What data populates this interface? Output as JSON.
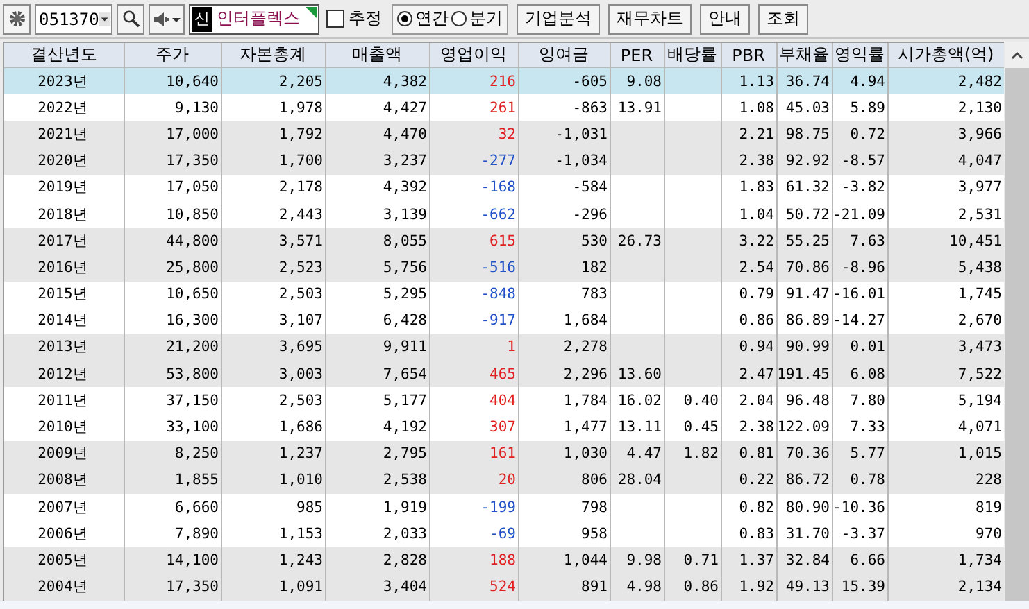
{
  "toolbar": {
    "code": "051370",
    "badge": "신",
    "stock_name": "인터플렉스",
    "estimate": {
      "label": "추정",
      "checked": false
    },
    "periods": [
      {
        "label": "연간",
        "selected": true
      },
      {
        "label": "분기",
        "selected": false
      }
    ],
    "buttons": [
      "기업분석",
      "재무차트",
      "안내",
      "조회"
    ]
  },
  "table": {
    "columns": [
      "결산년도",
      "주가",
      "자본총계",
      "매출액",
      "영업이익",
      "잉여금",
      "PER",
      "배당률",
      "PBR",
      "부채율",
      "영익률",
      "시가총액(억)"
    ],
    "rows": [
      {
        "selected": true,
        "color": "#e02020",
        "cells": [
          "2023년",
          "10,640",
          "2,205",
          "4,382",
          "216",
          "-605",
          "9.08",
          null,
          "1.13",
          "36.74",
          "4.94",
          "2,482"
        ]
      },
      {
        "selected": false,
        "color": "#e02020",
        "cells": [
          "2022년",
          "9,130",
          "1,978",
          "4,427",
          "261",
          "-863",
          "13.91",
          null,
          "1.08",
          "45.03",
          "5.89",
          "2,130"
        ]
      },
      {
        "selected": false,
        "color": "#e02020",
        "cells": [
          "2021년",
          "17,000",
          "1,792",
          "4,470",
          "32",
          "-1,031",
          null,
          null,
          "2.21",
          "98.75",
          "0.72",
          "3,966"
        ]
      },
      {
        "selected": false,
        "color": "#2050c8",
        "cells": [
          "2020년",
          "17,350",
          "1,700",
          "3,237",
          "-277",
          "-1,034",
          null,
          null,
          "2.38",
          "92.92",
          "-8.57",
          "4,047"
        ]
      },
      {
        "selected": false,
        "color": "#2050c8",
        "cells": [
          "2019년",
          "17,050",
          "2,178",
          "4,392",
          "-168",
          "-584",
          null,
          null,
          "1.83",
          "61.32",
          "-3.82",
          "3,977"
        ]
      },
      {
        "selected": false,
        "color": "#2050c8",
        "cells": [
          "2018년",
          "10,850",
          "2,443",
          "3,139",
          "-662",
          "-296",
          null,
          null,
          "1.04",
          "50.72",
          "-21.09",
          "2,531"
        ]
      },
      {
        "selected": false,
        "color": "#e02020",
        "cells": [
          "2017년",
          "44,800",
          "3,571",
          "8,055",
          "615",
          "530",
          "26.73",
          null,
          "3.22",
          "55.25",
          "7.63",
          "10,451"
        ]
      },
      {
        "selected": false,
        "color": "#2050c8",
        "cells": [
          "2016년",
          "25,800",
          "2,523",
          "5,756",
          "-516",
          "182",
          null,
          null,
          "2.54",
          "70.86",
          "-8.96",
          "5,438"
        ]
      },
      {
        "selected": false,
        "color": "#2050c8",
        "cells": [
          "2015년",
          "10,650",
          "2,503",
          "5,295",
          "-848",
          "783",
          null,
          null,
          "0.79",
          "91.47",
          "-16.01",
          "1,745"
        ]
      },
      {
        "selected": false,
        "color": "#2050c8",
        "cells": [
          "2014년",
          "16,300",
          "3,107",
          "6,428",
          "-917",
          "1,684",
          null,
          null,
          "0.86",
          "86.89",
          "-14.27",
          "2,670"
        ]
      },
      {
        "selected": false,
        "color": "#e02020",
        "cells": [
          "2013년",
          "21,200",
          "3,695",
          "9,911",
          "1",
          "2,278",
          null,
          null,
          "0.94",
          "90.99",
          "0.01",
          "3,473"
        ]
      },
      {
        "selected": false,
        "color": "#e02020",
        "cells": [
          "2012년",
          "53,800",
          "3,003",
          "7,654",
          "465",
          "2,296",
          "13.60",
          null,
          "2.47",
          "191.45",
          "6.08",
          "7,522"
        ]
      },
      {
        "selected": false,
        "color": "#e02020",
        "cells": [
          "2011년",
          "37,150",
          "2,503",
          "5,177",
          "404",
          "1,784",
          "16.02",
          "0.40",
          "2.04",
          "96.48",
          "7.80",
          "5,194"
        ]
      },
      {
        "selected": false,
        "color": "#e02020",
        "cells": [
          "2010년",
          "33,100",
          "1,686",
          "4,192",
          "307",
          "1,477",
          "13.11",
          "0.45",
          "2.38",
          "122.09",
          "7.33",
          "4,071"
        ]
      },
      {
        "selected": false,
        "color": "#e02020",
        "cells": [
          "2009년",
          "8,250",
          "1,237",
          "2,795",
          "161",
          "1,030",
          "4.47",
          "1.82",
          "0.81",
          "70.36",
          "5.77",
          "1,015"
        ]
      },
      {
        "selected": false,
        "color": "#e02020",
        "cells": [
          "2008년",
          "1,855",
          "1,010",
          "2,538",
          "20",
          "806",
          "28.04",
          null,
          "0.22",
          "86.72",
          "0.78",
          "228"
        ]
      },
      {
        "selected": false,
        "color": "#2050c8",
        "cells": [
          "2007년",
          "6,660",
          "985",
          "1,919",
          "-199",
          "798",
          null,
          null,
          "0.82",
          "80.90",
          "-10.36",
          "819"
        ]
      },
      {
        "selected": false,
        "color": "#2050c8",
        "cells": [
          "2006년",
          "7,890",
          "1,153",
          "2,033",
          "-69",
          "958",
          null,
          null,
          "0.83",
          "31.70",
          "-3.37",
          "970"
        ]
      },
      {
        "selected": false,
        "color": "#e02020",
        "cells": [
          "2005년",
          "14,100",
          "1,243",
          "2,828",
          "188",
          "1,044",
          "9.98",
          "0.71",
          "1.37",
          "32.84",
          "6.66",
          "1,734"
        ]
      },
      {
        "selected": false,
        "color": "#e02020",
        "cells": [
          "2004년",
          "17,350",
          "1,091",
          "3,404",
          "524",
          "891",
          "4.98",
          "0.86",
          "1.92",
          "49.13",
          "15.39",
          "2,134"
        ]
      }
    ]
  }
}
